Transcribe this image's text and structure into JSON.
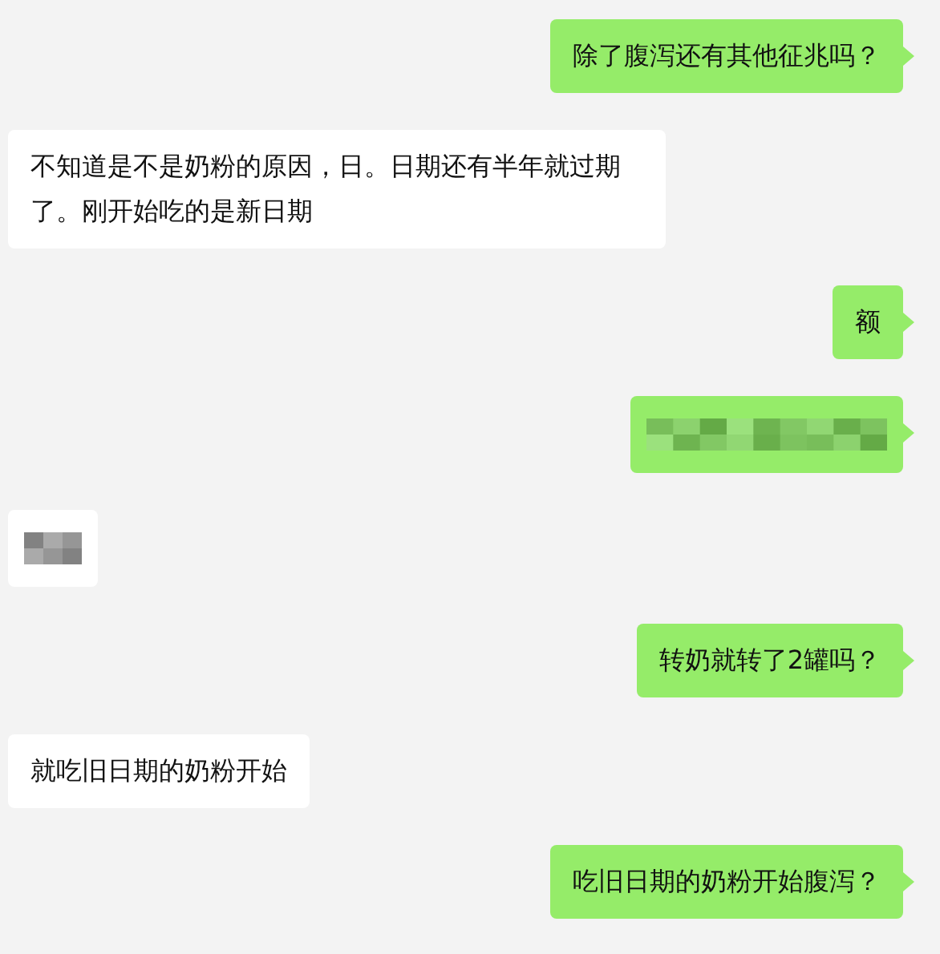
{
  "messages": [
    {
      "outgoing": true,
      "kind": "text",
      "text": "除了腹泻还有其他征兆吗？"
    },
    {
      "outgoing": false,
      "kind": "text",
      "text": "不知道是不是奶粉的原因，日。日期还有半年就过期了。刚开始吃的是新日期"
    },
    {
      "outgoing": true,
      "kind": "text",
      "text": "额"
    },
    {
      "outgoing": true,
      "kind": "redacted"
    },
    {
      "outgoing": false,
      "kind": "redacted"
    },
    {
      "outgoing": true,
      "kind": "text",
      "text": "转奶就转了2罐吗？"
    },
    {
      "outgoing": false,
      "kind": "text",
      "text": "就吃旧日期的奶粉开始"
    },
    {
      "outgoing": true,
      "kind": "text",
      "text": "吃旧日期的奶粉开始腹泻？"
    }
  ]
}
